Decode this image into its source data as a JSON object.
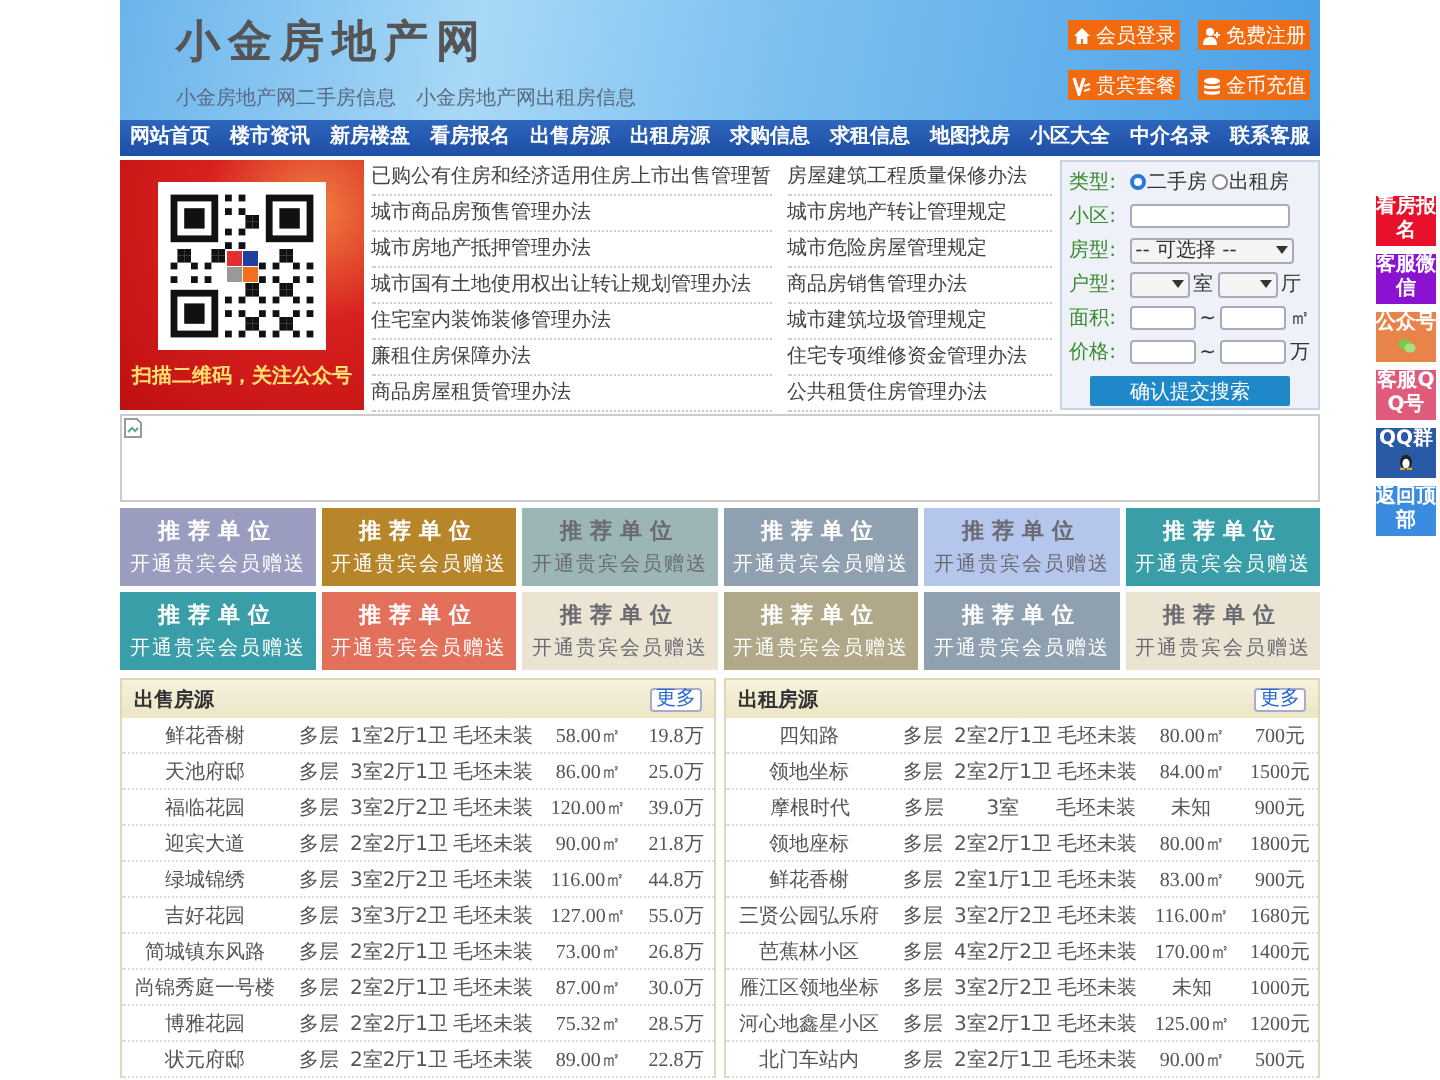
{
  "header": {
    "title": "小金房地产网",
    "links": [
      "小金房地产网二手房信息",
      "小金房地产网出租房信息"
    ],
    "buttons": [
      {
        "label": "会员登录"
      },
      {
        "label": "免费注册"
      },
      {
        "label": "贵宾套餐"
      },
      {
        "label": "金币充值"
      }
    ]
  },
  "nav": [
    "网站首页",
    "楼市资讯",
    "新房楼盘",
    "看房报名",
    "出售房源",
    "出租房源",
    "求购信息",
    "求租信息",
    "地图找房",
    "小区大全",
    "中介名录",
    "联系客服"
  ],
  "promo": {
    "caption": "扫描二维码，关注公众号"
  },
  "articles": [
    "已购公有住房和经济适用住房上市出售管理暂",
    "房屋建筑工程质量保修办法",
    "城市商品房预售管理办法",
    "城市房地产转让管理规定",
    "城市房地产抵押管理办法",
    "城市危险房屋管理规定",
    "城市国有土地使用权出让转让规划管理办法",
    "商品房销售管理办法",
    "住宅室内装饰装修管理办法",
    "城市建筑垃圾管理规定",
    "廉租住房保障办法",
    "住宅专项维修资金管理办法",
    "商品房屋租赁管理办法",
    "公共租赁住房管理办法"
  ],
  "search": {
    "rows": [
      {
        "kind": "radio",
        "label": "类型:",
        "options": [
          {
            "label": "二手房",
            "selected": true
          },
          {
            "label": "出租房",
            "selected": false
          }
        ]
      },
      {
        "kind": "text",
        "label": "小区:"
      },
      {
        "kind": "select",
        "label": "房型:",
        "value": "-- 可选择 --"
      },
      {
        "kind": "selects",
        "label": "户型:",
        "units": [
          "室",
          "厅"
        ]
      },
      {
        "kind": "range",
        "label": "面积:",
        "separator": "~",
        "unit": "㎡"
      },
      {
        "kind": "range",
        "label": "价格:",
        "separator": "~",
        "unit": "万"
      }
    ],
    "button": "确认提交搜索"
  },
  "tiles": [
    {
      "title": "推荐单位",
      "subtitle": "开通贵宾会员赠送",
      "color": "#9a9cc0"
    },
    {
      "title": "推荐单位",
      "subtitle": "开通贵宾会员赠送",
      "color": "#b8862a"
    },
    {
      "title": "推荐单位",
      "subtitle": "开通贵宾会员赠送",
      "color": "#9cb6b8"
    },
    {
      "title": "推荐单位",
      "subtitle": "开通贵宾会员赠送",
      "color": "#8fa0b0"
    },
    {
      "title": "推荐单位",
      "subtitle": "开通贵宾会员赠送",
      "color": "#b4c6ec"
    },
    {
      "title": "推荐单位",
      "subtitle": "开通贵宾会员赠送",
      "color": "#3a9ea8"
    },
    {
      "title": "推荐单位",
      "subtitle": "开通贵宾会员赠送",
      "color": "#3a9ea8"
    },
    {
      "title": "推荐单位",
      "subtitle": "开通贵宾会员赠送",
      "color": "#e2705a"
    },
    {
      "title": "推荐单位",
      "subtitle": "开通贵宾会员赠送",
      "color": "#ece4d2"
    },
    {
      "title": "推荐单位",
      "subtitle": "开通贵宾会员赠送",
      "color": "#b0a888"
    },
    {
      "title": "推荐单位",
      "subtitle": "开通贵宾会员赠送",
      "color": "#8fa0b0"
    },
    {
      "title": "推荐单位",
      "subtitle": "开通贵宾会员赠送",
      "color": "#ece4d2"
    }
  ],
  "listings": [
    {
      "title": "出售房源",
      "more": "更多",
      "rows": [
        [
          "鲜花香榭",
          "多层",
          "1室2厅1卫",
          "毛坯未装",
          "58.00㎡",
          "19.8万"
        ],
        [
          "天池府邸",
          "多层",
          "3室2厅1卫",
          "毛坯未装",
          "86.00㎡",
          "25.0万"
        ],
        [
          "福临花园",
          "多层",
          "3室2厅2卫",
          "毛坯未装",
          "120.00㎡",
          "39.0万"
        ],
        [
          "迎宾大道",
          "多层",
          "2室2厅1卫",
          "毛坯未装",
          "90.00㎡",
          "21.8万"
        ],
        [
          "绿城锦绣",
          "多层",
          "3室2厅2卫",
          "毛坯未装",
          "116.00㎡",
          "44.8万"
        ],
        [
          "吉好花园",
          "多层",
          "3室3厅2卫",
          "毛坯未装",
          "127.00㎡",
          "55.0万"
        ],
        [
          "简城镇东风路",
          "多层",
          "2室2厅1卫",
          "毛坯未装",
          "73.00㎡",
          "26.8万"
        ],
        [
          "尚锦秀庭一号楼",
          "多层",
          "2室2厅1卫",
          "毛坯未装",
          "87.00㎡",
          "30.0万"
        ],
        [
          "博雅花园",
          "多层",
          "2室2厅1卫",
          "毛坯未装",
          "75.32㎡",
          "28.5万"
        ],
        [
          "状元府邸",
          "多层",
          "2室2厅1卫",
          "毛坯未装",
          "89.00㎡",
          "22.8万"
        ]
      ]
    },
    {
      "title": "出租房源",
      "more": "更多",
      "rows": [
        [
          "四知路",
          "多层",
          "2室2厅1卫",
          "毛坯未装",
          "80.00㎡",
          "700元"
        ],
        [
          "领地坐标",
          "多层",
          "2室2厅1卫",
          "毛坯未装",
          "84.00㎡",
          "1500元"
        ],
        [
          "摩根时代",
          "多层",
          "3室",
          "毛坯未装",
          "未知",
          "900元"
        ],
        [
          "领地座标",
          "多层",
          "2室2厅1卫",
          "毛坯未装",
          "80.00㎡",
          "1800元"
        ],
        [
          "鲜花香榭",
          "多层",
          "2室1厅1卫",
          "毛坯未装",
          "83.00㎡",
          "900元"
        ],
        [
          "三贤公园弘乐府",
          "多层",
          "3室2厅2卫",
          "毛坯未装",
          "116.00㎡",
          "1680元"
        ],
        [
          "芭蕉林小区",
          "多层",
          "4室2厅2卫",
          "毛坯未装",
          "170.00㎡",
          "1400元"
        ],
        [
          "雁江区领地坐标",
          "多层",
          "3室2厅2卫",
          "毛坯未装",
          "未知",
          "1000元"
        ],
        [
          "河心地鑫星小区",
          "多层",
          "3室2厅1卫",
          "毛坯未装",
          "125.00㎡",
          "1200元"
        ],
        [
          "北门车站内",
          "多层",
          "2室2厅1卫",
          "毛坯未装",
          "90.00㎡",
          "500元"
        ]
      ]
    }
  ],
  "side": [
    {
      "label": "看房报名",
      "color": "#e8102a"
    },
    {
      "label": "客服微信",
      "color": "#8a12d0"
    },
    {
      "label": "公众号",
      "color": "#e8844a"
    },
    {
      "label": "客服QQ号",
      "color": "#e05a7c"
    },
    {
      "label": "QQ群",
      "color": "#2a5aa6"
    },
    {
      "label": "返回顶部",
      "color": "#3a8ce0"
    }
  ]
}
